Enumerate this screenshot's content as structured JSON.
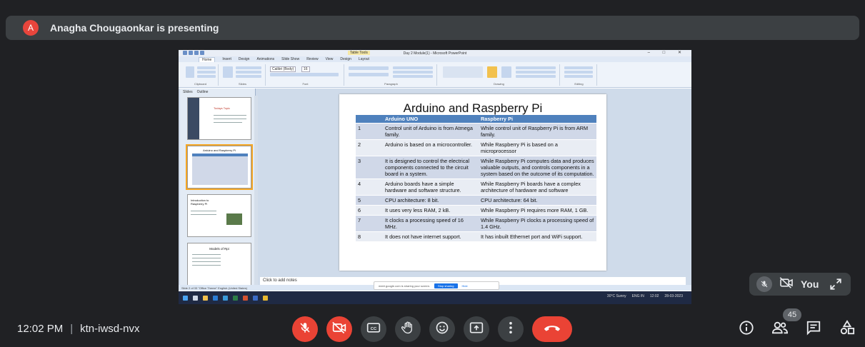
{
  "banner": {
    "avatar_letter": "A",
    "presenting_text": "Anagha Chougaonkar is presenting"
  },
  "powerpoint": {
    "window_title": "Day 2 Module(1) - Microsoft PowerPoint",
    "context_tab": "Table Tools",
    "tabs": [
      "Home",
      "Insert",
      "Design",
      "Animations",
      "Slide Show",
      "Review",
      "View",
      "Design",
      "Layout"
    ],
    "ribbon_groups": [
      "Clipboard",
      "Slides",
      "Font",
      "Paragraph",
      "Drawing",
      "Editing"
    ],
    "font_name": "Calibri (Body)",
    "font_size": "16",
    "panel_tabs": [
      "Slides",
      "Outline"
    ],
    "thumb_titles": [
      "Todays Topic",
      "Arduino and Raspberry Pi",
      "Introduction to Raspberry Pi",
      "Models of Rpi"
    ],
    "notes_placeholder": "Click to add notes",
    "status_text": "Slide 2 of 33   \"Office Theme\"   English (United States)",
    "share_notice": "meet.google.com is sharing your screen.",
    "stop_sharing": "Stop sharing",
    "hide": "Hide",
    "tray_weather": "30°C Sunny",
    "tray_lang": "ENG IN",
    "tray_time": "12:02",
    "tray_date": "28-03-2023"
  },
  "slide": {
    "title": "Arduino and Raspberry Pi",
    "headers": [
      "",
      "Arduino UNO",
      "Raspberry Pi"
    ],
    "rows": [
      [
        "1",
        "Control unit of Arduino is from Atmega family.",
        "While control unit of Raspberry Pi is from ARM family."
      ],
      [
        "2",
        "Arduino is based on a microcontroller.",
        "While Raspberry Pi is based on a microprocessor"
      ],
      [
        "3",
        "It is designed to control the electrical components connected to the circuit board in a system.",
        "While Raspberry Pi computes data and produces valuable outputs, and controls components in a system based on the outcome of its computation."
      ],
      [
        "4",
        "Arduino boards have a simple hardware and software structure.",
        "While Raspberry Pi boards have a complex architecture of hardware and software"
      ],
      [
        "5",
        "CPU architecture: 8 bit.",
        "CPU architecture: 64 bit."
      ],
      [
        "6",
        "It uses very less RAM, 2 kB.",
        "While Raspberry Pi requires more RAM, 1 GB."
      ],
      [
        "7",
        "It clocks a processing speed of 16 MHz.",
        "While Raspberry Pi clocks a processing speed of 1.4 GHz."
      ],
      [
        "8",
        "It does not have internet support.",
        "It has inbuilt Ethernet port and WiFi support."
      ]
    ]
  },
  "self_tile": {
    "label": "You"
  },
  "meeting": {
    "time": "12:02 PM",
    "separator": "|",
    "code": "ktn-iwsd-nvx",
    "participant_count": "45"
  },
  "colors": {
    "background": "#202124",
    "surface": "#3c4043",
    "danger": "#ea4335",
    "table_header": "#4f81bd"
  },
  "icons": {
    "controls": [
      "mic-off-icon",
      "camera-off-icon",
      "captions-icon",
      "raise-hand-icon",
      "emoji-icon",
      "present-icon",
      "more-options-icon",
      "end-call-icon"
    ],
    "right": [
      "info-icon",
      "people-icon",
      "chat-icon",
      "activities-icon"
    ]
  }
}
